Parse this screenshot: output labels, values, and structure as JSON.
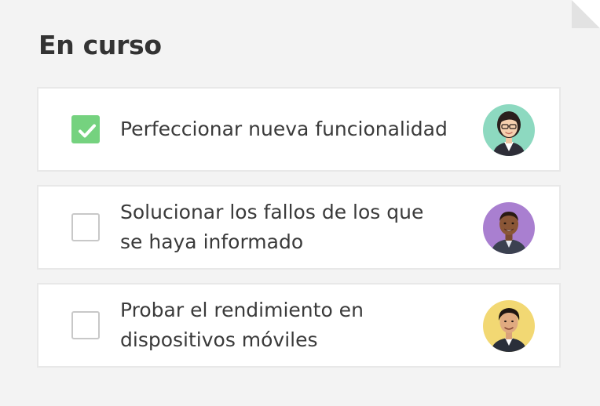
{
  "section": {
    "title": "En curso"
  },
  "tasks": [
    {
      "label": "Perfeccionar nueva funcionalidad",
      "checked": true,
      "avatar_bg": "#8dd9c0"
    },
    {
      "label": "Solucionar los fallos de los que\nse haya informado",
      "checked": false,
      "avatar_bg": "#a97fd0"
    },
    {
      "label": "Probar el rendimiento en\ndispositivos móviles",
      "checked": false,
      "avatar_bg": "#f2d873"
    }
  ],
  "colors": {
    "background": "#f3f3f3",
    "card_border": "#e8e8e8",
    "check_green": "#75d27f",
    "text": "#333333"
  }
}
